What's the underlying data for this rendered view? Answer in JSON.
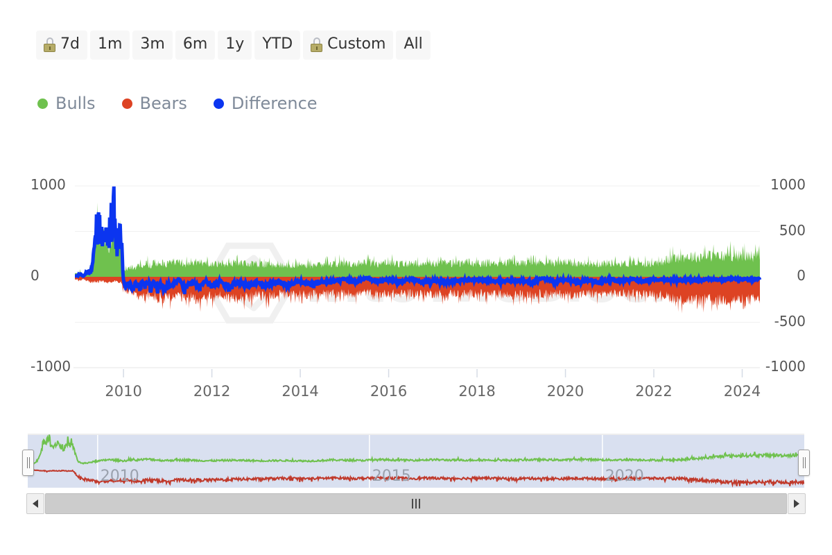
{
  "range_selector": {
    "buttons": [
      {
        "label": "7d",
        "locked": true,
        "selected": false
      },
      {
        "label": "1m",
        "locked": false,
        "selected": false
      },
      {
        "label": "3m",
        "locked": false,
        "selected": false
      },
      {
        "label": "6m",
        "locked": false,
        "selected": false
      },
      {
        "label": "1y",
        "locked": false,
        "selected": false
      },
      {
        "label": "YTD",
        "locked": false,
        "selected": false
      },
      {
        "label": "Custom",
        "locked": true,
        "selected": false
      },
      {
        "label": "All",
        "locked": false,
        "selected": true
      }
    ],
    "lock_icon": "lock-icon"
  },
  "legend": {
    "items": [
      {
        "label": "Bulls",
        "color": "#6fc14e"
      },
      {
        "label": "Bears",
        "color": "#dd4323"
      },
      {
        "label": "Difference",
        "color": "#0b35f0"
      }
    ]
  },
  "watermark": {
    "text": "IntoTheBlock",
    "color": "#f0f0f0"
  },
  "scrollbar": {
    "left_arrow_icon": "triangle-left-icon",
    "right_arrow_icon": "triangle-right-icon",
    "grip_icon": "grip-icon",
    "thumb_start_pct": 0,
    "thumb_end_pct": 100
  },
  "navigator": {
    "year_labels": [
      "2010",
      "2015",
      "2020"
    ],
    "year_positions_pct": [
      9.0,
      44.0,
      74.0
    ],
    "selection_start_pct": 0.0,
    "selection_end_pct": 100.0,
    "left_handle_icon": "nav-handle-left",
    "right_handle_icon": "nav-handle-right"
  },
  "chart_data": {
    "type": "area",
    "title": "",
    "subtitle": "",
    "xlabel": "",
    "ylabel": "",
    "grid": true,
    "legend_position": "top-left",
    "ylim": [
      -1000,
      1000
    ],
    "y_ticks": [
      1000,
      500,
      0,
      -500,
      -1000
    ],
    "y_tick_labels_left": [
      "1000",
      "0",
      "-1000"
    ],
    "y_tick_labels_right": [
      "1000",
      "500",
      "0",
      "-500",
      "-1000"
    ],
    "xlim": [
      2008.9,
      2024.4
    ],
    "x_ticks": [
      2010,
      2012,
      2014,
      2016,
      2018,
      2020,
      2022,
      2024
    ],
    "x_tick_labels": [
      "2010",
      "2012",
      "2014",
      "2016",
      "2018",
      "2020",
      "2022",
      "2024"
    ],
    "series": [
      {
        "name": "Bulls",
        "color": "#6fc14e",
        "fill": true,
        "x": [
          2008.95,
          2009.02,
          2009.09,
          2009.16,
          2009.23,
          2009.3,
          2009.37,
          2009.44,
          2009.51,
          2009.58,
          2009.65,
          2009.72,
          2009.79,
          2009.86,
          2009.93,
          2010.0,
          2010.07,
          2010.14,
          2010.21,
          2010.28,
          2010.35,
          2010.42,
          2010.49,
          2010.56,
          2010.63,
          2010.7,
          2010.77,
          2010.84,
          2010.91,
          2010.98,
          2011.1,
          2011.25,
          2011.4,
          2011.55,
          2011.7,
          2011.85,
          2012.0,
          2012.2,
          2012.4,
          2012.6,
          2012.8,
          2013.0,
          2013.25,
          2013.5,
          2013.75,
          2014.0,
          2014.25,
          2014.5,
          2014.75,
          2015.0,
          2015.25,
          2015.5,
          2015.75,
          2016.0,
          2016.25,
          2016.5,
          2016.75,
          2017.0,
          2017.25,
          2017.5,
          2017.75,
          2018.0,
          2018.25,
          2018.5,
          2018.75,
          2019.0,
          2019.25,
          2019.5,
          2019.75,
          2020.0,
          2020.25,
          2020.5,
          2020.75,
          2021.0,
          2021.25,
          2021.5,
          2021.75,
          2022.0,
          2022.2,
          2022.4,
          2022.6,
          2022.8,
          2023.0,
          2023.25,
          2023.5,
          2023.75,
          2024.0,
          2024.25
        ],
        "y": [
          40,
          55,
          30,
          60,
          90,
          150,
          420,
          520,
          370,
          480,
          300,
          420,
          560,
          240,
          520,
          60,
          75,
          95,
          110,
          90,
          130,
          120,
          150,
          140,
          120,
          160,
          135,
          150,
          125,
          145,
          155,
          180,
          140,
          170,
          150,
          165,
          130,
          150,
          140,
          160,
          135,
          145,
          130,
          140,
          125,
          135,
          120,
          130,
          145,
          150,
          135,
          160,
          145,
          155,
          140,
          150,
          135,
          145,
          150,
          140,
          160,
          145,
          155,
          140,
          165,
          150,
          145,
          170,
          155,
          160,
          145,
          150,
          140,
          155,
          145,
          150,
          140,
          150,
          170,
          200,
          215,
          225,
          220,
          230,
          225,
          235,
          230,
          228
        ]
      },
      {
        "name": "Bears",
        "color": "#dd4323",
        "fill": true,
        "x": [
          2008.95,
          2009.02,
          2009.09,
          2009.16,
          2009.23,
          2009.3,
          2009.37,
          2009.44,
          2009.51,
          2009.58,
          2009.65,
          2009.72,
          2009.79,
          2009.86,
          2009.93,
          2010.0,
          2010.07,
          2010.14,
          2010.21,
          2010.28,
          2010.35,
          2010.42,
          2010.49,
          2010.56,
          2010.63,
          2010.7,
          2010.77,
          2010.84,
          2010.91,
          2010.98,
          2011.1,
          2011.25,
          2011.4,
          2011.55,
          2011.7,
          2011.85,
          2012.0,
          2012.2,
          2012.4,
          2012.6,
          2012.8,
          2013.0,
          2013.25,
          2013.5,
          2013.75,
          2014.0,
          2014.25,
          2014.5,
          2014.75,
          2015.0,
          2015.25,
          2015.5,
          2015.75,
          2016.0,
          2016.25,
          2016.5,
          2016.75,
          2017.0,
          2017.25,
          2017.5,
          2017.75,
          2018.0,
          2018.25,
          2018.5,
          2018.75,
          2019.0,
          2019.25,
          2019.5,
          2019.75,
          2020.0,
          2020.25,
          2020.5,
          2020.75,
          2021.0,
          2021.25,
          2021.5,
          2021.75,
          2022.0,
          2022.2,
          2022.4,
          2022.6,
          2022.8,
          2023.0,
          2023.25,
          2023.5,
          2023.75,
          2024.0,
          2024.25
        ],
        "y": [
          -30,
          -45,
          -25,
          -40,
          -55,
          -60,
          -50,
          -55,
          -45,
          -60,
          -50,
          -55,
          -45,
          -50,
          -60,
          -120,
          -180,
          -150,
          -210,
          -170,
          -230,
          -190,
          -250,
          -200,
          -240,
          -210,
          -260,
          -220,
          -250,
          -230,
          -240,
          -200,
          -260,
          -220,
          -250,
          -210,
          -230,
          -200,
          -240,
          -210,
          -230,
          -200,
          -220,
          -190,
          -210,
          -185,
          -200,
          -180,
          -195,
          -175,
          -190,
          -170,
          -200,
          -180,
          -195,
          -175,
          -190,
          -185,
          -200,
          -180,
          -195,
          -175,
          -200,
          -185,
          -210,
          -190,
          -205,
          -185,
          -200,
          -190,
          -205,
          -185,
          -195,
          -180,
          -190,
          -175,
          -185,
          -180,
          -200,
          -230,
          -250,
          -255,
          -260,
          -255,
          -258,
          -252,
          -256,
          -254
        ]
      },
      {
        "name": "Difference",
        "color": "#0b35f0",
        "fill": false,
        "x": [
          2008.95,
          2009.02,
          2009.09,
          2009.16,
          2009.23,
          2009.3,
          2009.37,
          2009.44,
          2009.51,
          2009.58,
          2009.65,
          2009.72,
          2009.79,
          2009.86,
          2009.93,
          2010.0,
          2010.07,
          2010.14,
          2010.21,
          2010.28,
          2010.35,
          2010.42,
          2010.49,
          2010.56,
          2010.63,
          2010.7,
          2010.77,
          2010.84,
          2010.91,
          2010.98,
          2011.1,
          2011.25,
          2011.4,
          2011.55,
          2011.7,
          2011.85,
          2012.0,
          2012.2,
          2012.4,
          2012.6,
          2012.8,
          2013.0,
          2013.25,
          2013.5,
          2013.75,
          2014.0,
          2014.25,
          2014.5,
          2014.75,
          2015.0,
          2015.25,
          2015.5,
          2015.75,
          2016.0,
          2016.25,
          2016.5,
          2016.75,
          2017.0,
          2017.25,
          2017.5,
          2017.75,
          2018.0,
          2018.25,
          2018.5,
          2018.75,
          2019.0,
          2019.25,
          2019.5,
          2019.75,
          2020.0,
          2020.25,
          2020.5,
          2020.75,
          2021.0,
          2021.25,
          2021.5,
          2021.75,
          2022.0,
          2022.2,
          2022.4,
          2022.6,
          2022.8,
          2023.0,
          2023.25,
          2023.5,
          2023.75,
          2024.0,
          2024.25
        ],
        "y": [
          10,
          30,
          5,
          35,
          60,
          110,
          480,
          600,
          420,
          560,
          350,
          490,
          650,
          270,
          600,
          -60,
          -105,
          -55,
          -100,
          -80,
          -100,
          -70,
          -100,
          -60,
          -120,
          -50,
          -125,
          -70,
          -125,
          -85,
          -85,
          -20,
          -120,
          -50,
          -100,
          -45,
          -100,
          -50,
          -100,
          -50,
          -95,
          -55,
          -90,
          -50,
          -85,
          -50,
          -80,
          -50,
          -50,
          -25,
          -55,
          -10,
          -55,
          -25,
          -55,
          -25,
          -55,
          -40,
          -50,
          -40,
          -35,
          -30,
          -45,
          -45,
          -45,
          -40,
          -60,
          -15,
          -45,
          -30,
          -60,
          -35,
          -55,
          -25,
          -45,
          -25,
          -45,
          -30,
          -30,
          -30,
          -35,
          -30,
          -40,
          -25,
          -33,
          -17,
          -26,
          -26
        ]
      }
    ],
    "navigator_series": [
      {
        "name": "Bulls",
        "color": "#6fc14e",
        "x": [
          2008.95,
          2009.1,
          2009.2,
          2009.3,
          2009.4,
          2009.5,
          2009.6,
          2009.7,
          2009.8,
          2009.9,
          2010.0,
          2010.2,
          2010.5,
          2010.8,
          2011.0,
          2011.3,
          2011.6,
          2012.0,
          2012.5,
          2013.0,
          2013.5,
          2014.0,
          2014.5,
          2015.0,
          2015.5,
          2016.0,
          2016.5,
          2017.0,
          2017.5,
          2018.0,
          2018.5,
          2019.0,
          2019.5,
          2020.0,
          2020.5,
          2021.0,
          2021.5,
          2022.0,
          2022.4,
          2022.8,
          2023.2,
          2023.6,
          2024.0,
          2024.3
        ],
        "y": [
          40,
          120,
          400,
          520,
          380,
          470,
          330,
          440,
          400,
          120,
          80,
          110,
          150,
          130,
          140,
          160,
          135,
          145,
          130,
          140,
          130,
          135,
          125,
          145,
          135,
          150,
          140,
          150,
          140,
          145,
          140,
          150,
          145,
          155,
          145,
          150,
          140,
          150,
          180,
          215,
          225,
          228,
          230,
          228
        ]
      },
      {
        "name": "Bears",
        "color": "#c0392b",
        "x": [
          2008.95,
          2009.1,
          2009.2,
          2009.3,
          2009.4,
          2009.5,
          2009.6,
          2009.7,
          2009.8,
          2009.9,
          2010.0,
          2010.2,
          2010.5,
          2010.8,
          2011.0,
          2011.3,
          2011.6,
          2012.0,
          2012.5,
          2013.0,
          2013.5,
          2014.0,
          2014.5,
          2015.0,
          2015.5,
          2016.0,
          2016.5,
          2017.0,
          2017.5,
          2018.0,
          2018.5,
          2019.0,
          2019.5,
          2020.0,
          2020.5,
          2021.0,
          2021.5,
          2022.0,
          2022.4,
          2022.8,
          2023.2,
          2023.6,
          2024.0,
          2024.3
        ],
        "y": [
          -30,
          -45,
          -50,
          -55,
          -50,
          -55,
          -48,
          -55,
          -50,
          -150,
          -200,
          -230,
          -245,
          -225,
          -240,
          -215,
          -235,
          -215,
          -220,
          -205,
          -200,
          -190,
          -195,
          -180,
          -190,
          -180,
          -188,
          -185,
          -190,
          -182,
          -195,
          -188,
          -196,
          -188,
          -195,
          -182,
          -190,
          -195,
          -225,
          -252,
          -258,
          -254,
          -256,
          -254
        ]
      }
    ]
  }
}
